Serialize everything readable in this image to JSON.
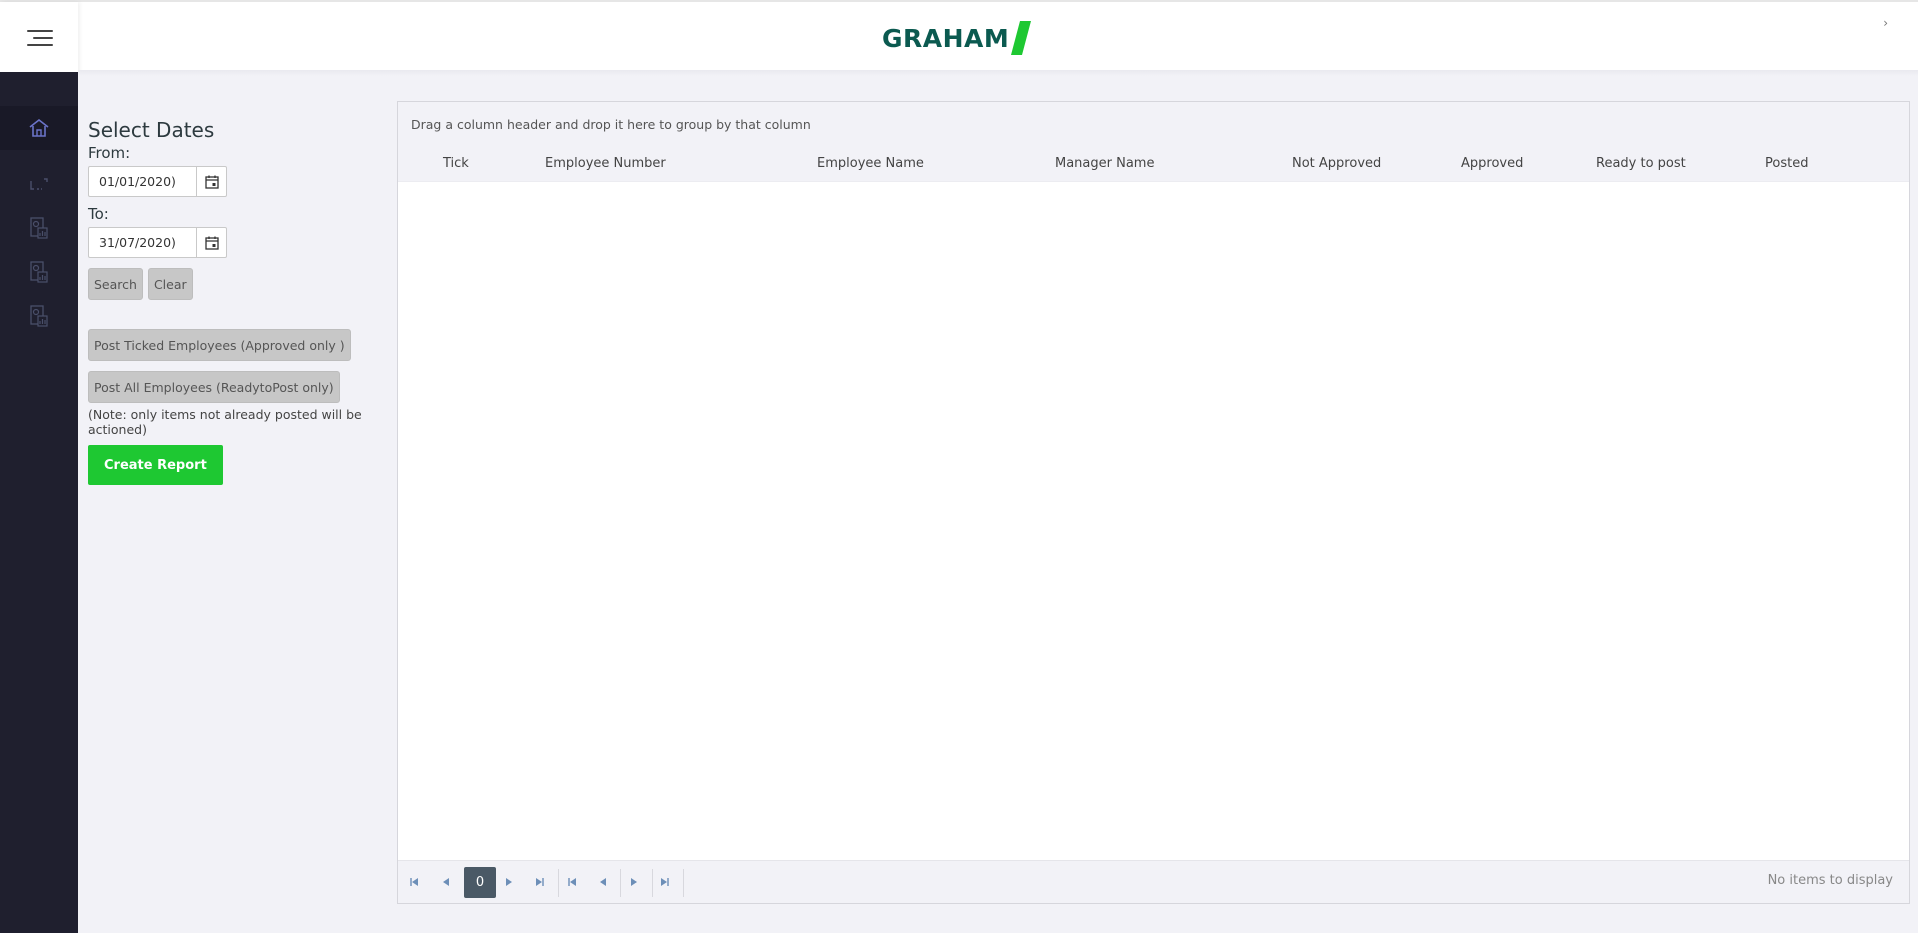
{
  "header": {
    "logo_text": "GRAHAM",
    "logo_color": "#0b5a50",
    "logo_accent": "#1ec832",
    "collapse_glyph": "›"
  },
  "sidebar": {
    "bg": "#1f1f2e",
    "items": [
      {
        "icon": "home-icon"
      },
      {
        "icon": "expand-arrows-icon"
      },
      {
        "icon": "report-icon"
      },
      {
        "icon": "report-icon"
      },
      {
        "icon": "report-icon"
      }
    ]
  },
  "filters": {
    "title": "Select Dates",
    "from_label": "From:",
    "from_value": "01/01/2020)",
    "to_label": "To:",
    "to_value": "31/07/2020)",
    "search_label": "Search",
    "clear_label": "Clear",
    "post_ticked_label": "Post Ticked Employees (Approved only )",
    "post_all_label": "Post All Employees (ReadytoPost only)",
    "note": "(Note: only items not already posted will be actioned)",
    "create_report_label": "Create Report"
  },
  "grid": {
    "group_hint": "Drag a column header and drop it here to group by that column",
    "columns": [
      "Tick",
      "Employee Number",
      "Employee Name",
      "Manager Name",
      "Not Approved",
      "Approved",
      "Ready to post",
      "Posted"
    ],
    "rows": [],
    "pager": {
      "current_page": "0",
      "status": "No items to display"
    }
  }
}
